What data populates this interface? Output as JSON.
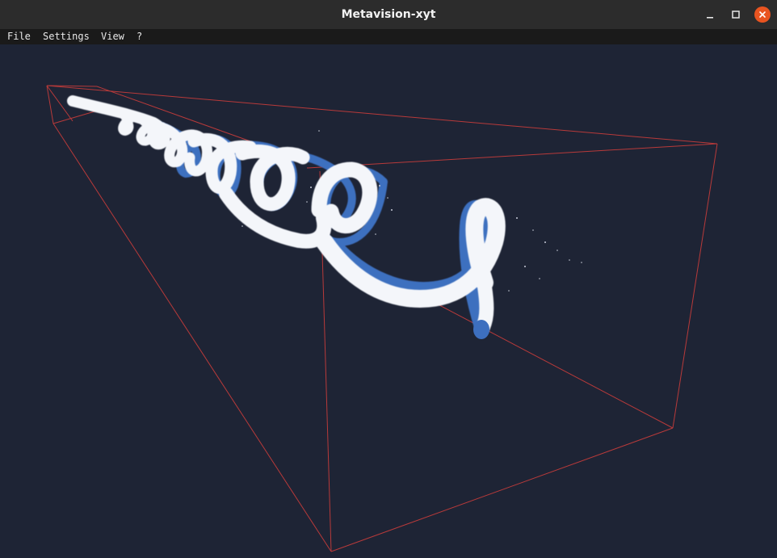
{
  "window": {
    "title": "Metavision-xyt"
  },
  "controls": {
    "minimize_icon": "minimize-icon",
    "maximize_icon": "maximize-icon",
    "close_icon": "close-icon",
    "close_color": "#e95420"
  },
  "menu": {
    "items": [
      {
        "label": "File"
      },
      {
        "label": "Settings"
      },
      {
        "label": "View"
      },
      {
        "label": "?"
      }
    ]
  },
  "scene": {
    "background_color": "#1e2435",
    "bounding_box_color": "#b83a3a",
    "event_color_primary": "#ffffff",
    "event_color_secondary": "#3d6fbf"
  }
}
